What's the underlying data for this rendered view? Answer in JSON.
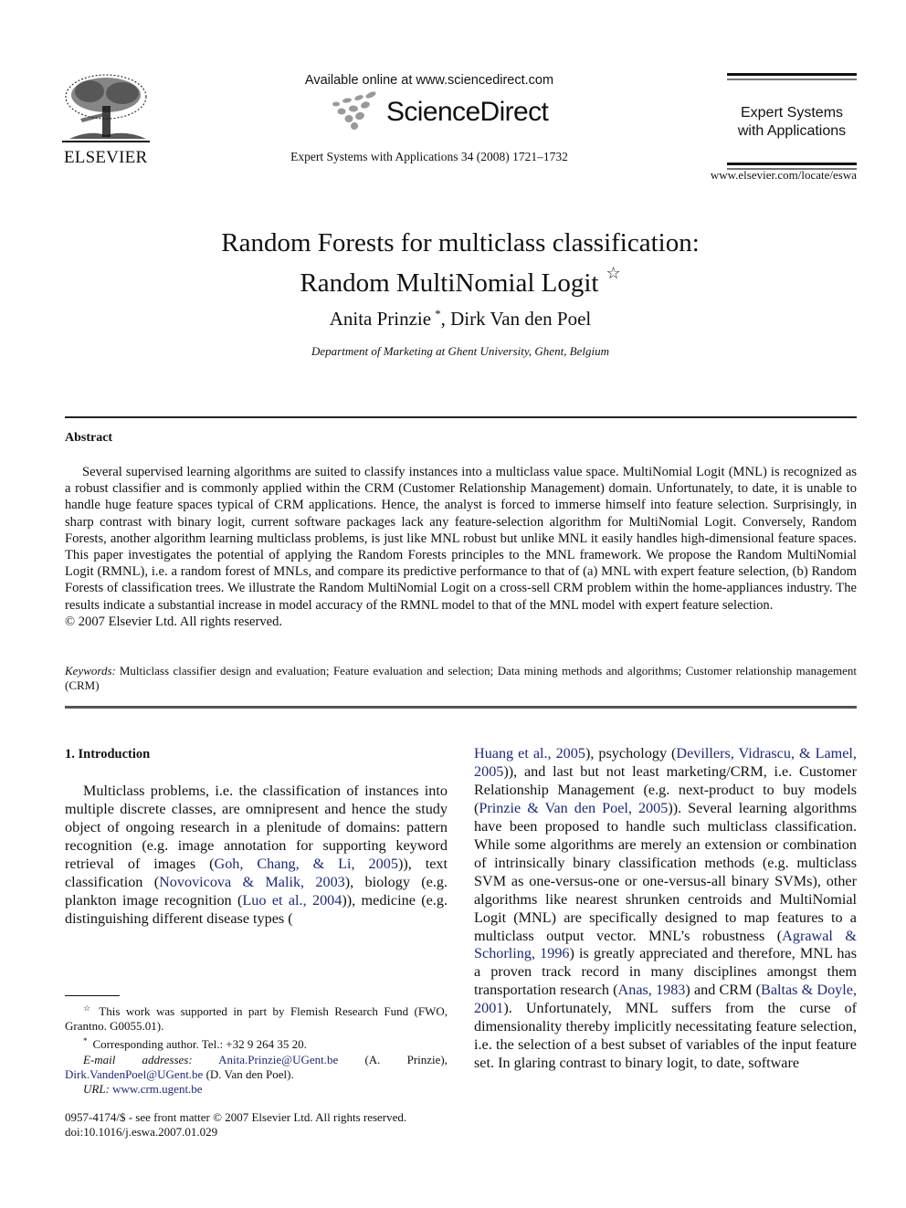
{
  "header": {
    "publisher_wordmark": "ELSEVIER",
    "available_online": "Available online at www.sciencedirect.com",
    "sciencedirect_wordmark": "ScienceDirect",
    "journal_reference": "Expert Systems with Applications 34 (2008) 1721–1732",
    "journal_box_title_line1": "Expert Systems",
    "journal_box_title_line2": "with Applications",
    "journal_url": "www.elsevier.com/locate/eswa"
  },
  "article": {
    "title_line1": "Random Forests for multiclass classification:",
    "title_line2": "Random MultiNomial Logit",
    "title_note_mark": "☆",
    "author1": "Anita Prinzie",
    "author1_mark": "*",
    "author_separator": ", ",
    "author2": "Dirk Van den Poel",
    "affiliation": "Department of Marketing at Ghent University, Ghent, Belgium"
  },
  "abstract": {
    "heading": "Abstract",
    "body": "Several supervised learning algorithms are suited to classify instances into a multiclass value space. MultiNomial Logit (MNL) is recognized as a robust classifier and is commonly applied within the CRM (Customer Relationship Management) domain. Unfortunately, to date, it is unable to handle huge feature spaces typical of CRM applications. Hence, the analyst is forced to immerse himself into feature selection. Surprisingly, in sharp contrast with binary logit, current software packages lack any feature-selection algorithm for MultiNomial Logit. Conversely, Random Forests, another algorithm learning multiclass problems, is just like MNL robust but unlike MNL it easily handles high-dimensional feature spaces. This paper investigates the potential of applying the Random Forests principles to the MNL framework. We propose the Random MultiNomial Logit (RMNL), i.e. a random forest of MNLs, and compare its predictive performance to that of (a) MNL with expert feature selection, (b) Random Forests of classification trees. We illustrate the Random MultiNomial Logit on a cross-sell CRM problem within the home-appliances industry. The results indicate a substantial increase in model accuracy of the RMNL model to that of the MNL model with expert feature selection.",
    "copyright": "© 2007 Elsevier Ltd. All rights reserved."
  },
  "keywords": {
    "label": "Keywords:",
    "text": "Multiclass classifier design and evaluation; Feature evaluation and selection; Data mining methods and algorithms; Customer relationship management (CRM)"
  },
  "introduction": {
    "heading": "1. Introduction",
    "segments": {
      "s1": "Multiclass problems, i.e. the classification of instances into multiple discrete classes, are omnipresent and hence the study object of ongoing research in a plenitude of domains: pattern recognition (e.g. image annotation for supporting keyword retrieval of images (",
      "c1": "Goh, Chang, & Li, 2005",
      "s2": ")), text classification (",
      "c2": "Novovicova & Malik, 2003",
      "s3": "), biology (e.g. plankton image recognition (",
      "c3": "Luo et al., 2004",
      "s4": ")), medicine (e.g. distinguishing different disease types (",
      "c4": "Huang et al., 2005",
      "s5": "), psychology (",
      "c5": "Devillers, Vidrascu, & Lamel, 2005",
      "s6": ")), and last but not least marketing/CRM, i.e. Customer Relationship Management (e.g. next-product to buy models (",
      "c6": "Prinzie & Van den Poel, 2005",
      "s7": ")). Several learning algorithms have been proposed to handle such multiclass classification. While some algorithms are merely an extension or combination of intrinsically binary classification methods (e.g. multiclass SVM as one-versus-one or one-versus-all binary SVMs), other algorithms like nearest shrunken centroids and MultiNomial Logit (MNL) are specifically designed to map features to a multiclass output vector. MNL’s robustness (",
      "c7": "Agrawal & Schorling, 1996",
      "s8": ") is greatly appreciated and therefore, MNL has a proven track record in many disciplines amongst them transportation research (",
      "c8": "Anas, 1983",
      "s9": ") and CRM (",
      "c9": "Baltas & Doyle, 2001",
      "s10": "). Unfortunately, MNL suffers from the curse of dimensionality thereby implicitly necessitating feature selection, i.e. the selection of a best subset of variables of the input feature set. In glaring contrast to binary logit, to date, software"
    }
  },
  "footnotes": {
    "fn1_mark": "☆",
    "fn1_text": "This work was supported in part by Flemish Research Fund (FWO, Grantno. G0055.01).",
    "fn2_mark": "*",
    "fn2_text": "Corresponding author. Tel.: +32 9 264 35 20.",
    "email_label": "E-mail addresses:",
    "email1": "Anita.Prinzie@UGent.be",
    "email1_owner": " (A. Prinzie), ",
    "email2": "Dirk.VandenPoel@UGent.be",
    "email2_owner": " (D. Van den Poel).",
    "url_label": "URL:",
    "url": "www.crm.ugent.be"
  },
  "front_matter": {
    "issn_line": "0957-4174/$ - see front matter © 2007 Elsevier Ltd. All rights reserved.",
    "doi_line": "doi:10.1016/j.eswa.2007.01.029"
  },
  "colors": {
    "link": "#1a2a7a",
    "text": "#111111",
    "rule": "#222222"
  }
}
